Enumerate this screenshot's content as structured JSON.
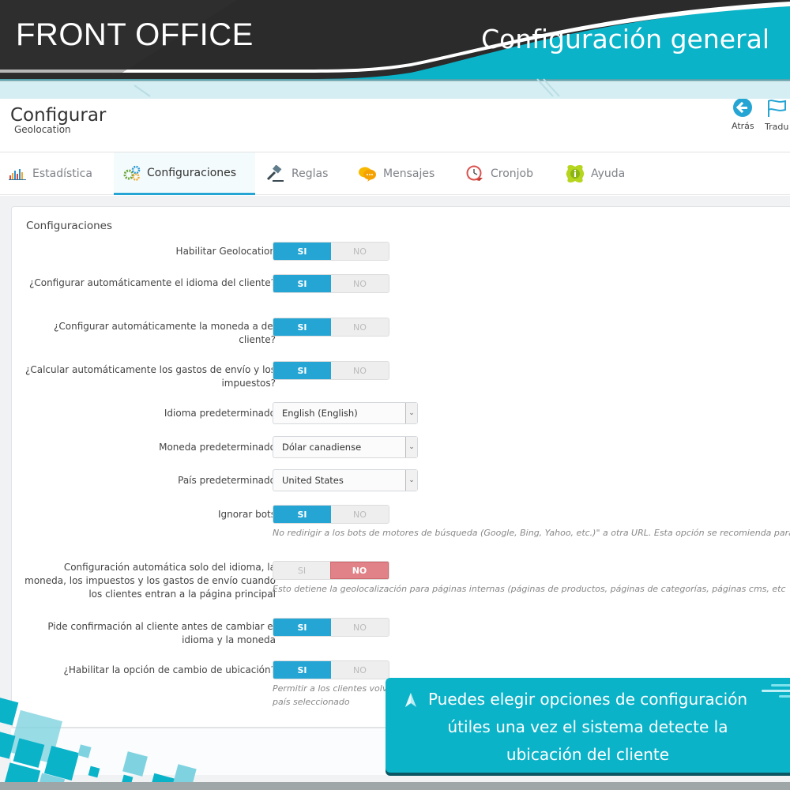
{
  "banner": {
    "left_title": "FRONT OFFICE",
    "right_title": "Configuración general",
    "accent_color": "#0bb3c9",
    "dark_color": "#2b2b2b"
  },
  "header": {
    "title": "Configurar",
    "subtitle": "Geolocation",
    "toolbar": [
      {
        "label": "Atrás",
        "icon": "arrow-left-circle-icon"
      },
      {
        "label": "Tradu",
        "icon": "flag-icon"
      }
    ]
  },
  "tabs": [
    {
      "label": "Estadística",
      "icon": "bar-chart-icon",
      "active": false
    },
    {
      "label": "Configuraciones",
      "icon": "gears-icon",
      "active": true
    },
    {
      "label": "Reglas",
      "icon": "gavel-icon",
      "active": false
    },
    {
      "label": "Mensajes",
      "icon": "chat-bubbles-icon",
      "active": false
    },
    {
      "label": "Cronjob",
      "icon": "clock-icon",
      "active": false
    },
    {
      "label": "Ayuda",
      "icon": "info-icon",
      "active": false
    }
  ],
  "panel": {
    "title": "Configuraciones",
    "switch_labels": {
      "yes": "SI",
      "no": "NO"
    },
    "settings": [
      {
        "label": "Habilitar Geolocation",
        "type": "switch",
        "value": "SI"
      },
      {
        "label": "¿Configurar automáticamente el idioma del cliente?",
        "type": "switch",
        "value": "SI"
      },
      {
        "label": "¿Configurar automáticamente la moneda a del cliente?",
        "type": "switch",
        "value": "SI"
      },
      {
        "label": "¿Calcular automáticamente los gastos de envío y los impuestos?",
        "type": "switch",
        "value": "SI"
      },
      {
        "label": "Idioma predeterminado",
        "type": "select",
        "value": "English (English)"
      },
      {
        "label": "Moneda predeterminado",
        "type": "select",
        "value": "Dólar canadiense"
      },
      {
        "label": "País predeterminado",
        "type": "select",
        "value": "United States"
      },
      {
        "label": "Ignorar bots",
        "type": "switch",
        "value": "SI",
        "help": "No redirigir a los bots de motores de búsqueda (Google, Bing, Yahoo, etc.)\" a otra URL. Esta opción se recomienda para l"
      },
      {
        "label": "Configuración automática solo del idioma, la moneda, los impuestos y los gastos de envío cuando los clientes entran a la página principal",
        "type": "switch",
        "value": "NO",
        "help": "Esto detiene la geolocalización para páginas internas (páginas de productos, páginas de categorías, páginas cms, etc"
      },
      {
        "label": "Pide confirmación al cliente antes de cambiar el idioma y la moneda",
        "type": "switch",
        "value": "SI"
      },
      {
        "label": "¿Habilitar la opción de cambio de ubicación?",
        "type": "switch",
        "value": "SI",
        "help_lines": [
          "Permitir a los clientes volv",
          "país seleccionado"
        ]
      }
    ]
  },
  "callout": {
    "text": "Puedes elegir opciones de configuración útiles una vez el sistema detecte la ubicación del cliente",
    "lines": [
      "Puedes elegir opciones de configuración",
      "útiles una vez el sistema detecte la",
      "ubicación del cliente"
    ]
  },
  "colors": {
    "switch_on": "#25a5d3",
    "switch_no_active": "#e08287",
    "callout_bg": "#0bb3c9"
  }
}
